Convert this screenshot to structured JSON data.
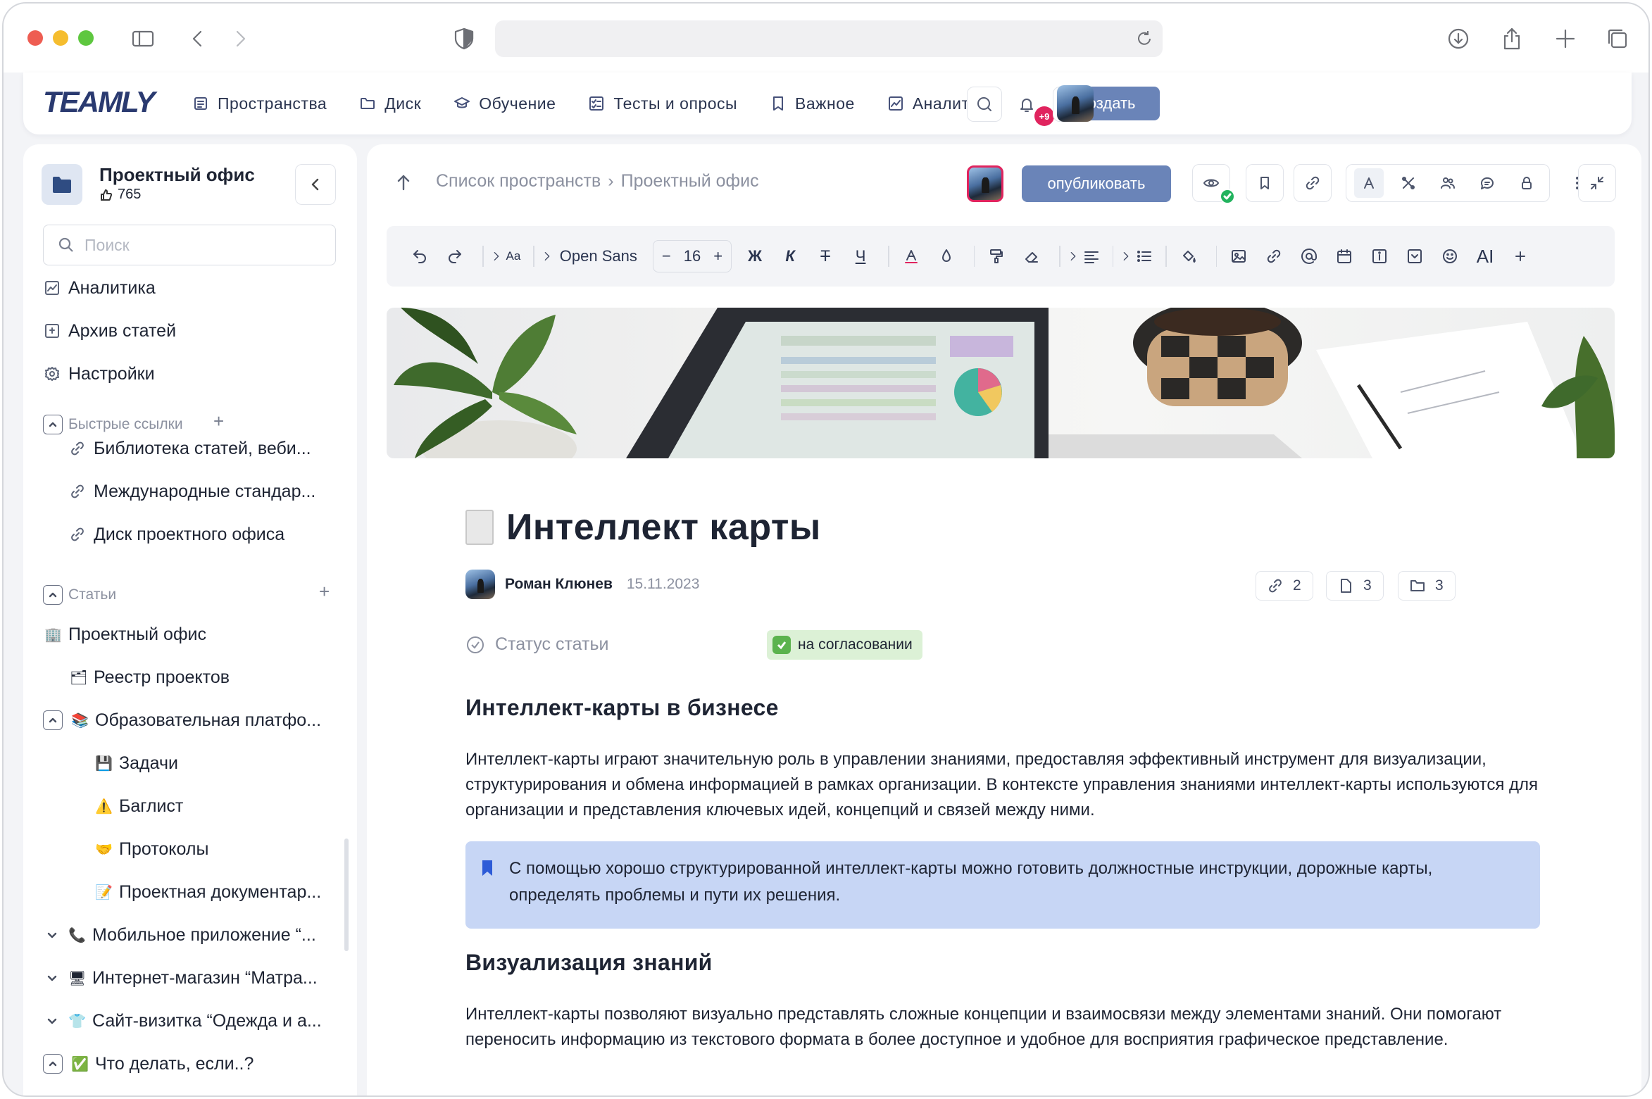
{
  "app": {
    "logo": "TEAMLY",
    "nav": [
      {
        "label": "Пространства",
        "icon": "spaces-icon"
      },
      {
        "label": "Диск",
        "icon": "folder-icon"
      },
      {
        "label": "Обучение",
        "icon": "graduation-icon"
      },
      {
        "label": "Тесты и опросы",
        "icon": "checklist-icon"
      },
      {
        "label": "Важное",
        "icon": "bookmark-icon"
      },
      {
        "label": "Аналитика",
        "icon": "analytics-icon"
      }
    ],
    "create_label": "создать",
    "notifications_badge": "+9"
  },
  "sidebar": {
    "space_title": "Проектный офис",
    "likes": "765",
    "search_placeholder": "Поиск",
    "top_items": [
      {
        "label": "Аналитика",
        "icon": "analytics-icon"
      },
      {
        "label": "Архив статей",
        "icon": "archive-icon"
      },
      {
        "label": "Настройки",
        "icon": "gear-icon"
      }
    ],
    "quick_links_title": "Быстрые ссылки",
    "quick_links": [
      "Библиотека статей, веби...",
      "Международные стандар...",
      "Диск проектного офиса"
    ],
    "articles_title": "Статьи",
    "articles": [
      {
        "label": "Проектный офис",
        "emoji": "🏢",
        "level": 0
      },
      {
        "label": "Реестр проектов",
        "emoji": "🗂",
        "level": 1
      },
      {
        "label": "Образовательная платфо...",
        "emoji": "📚",
        "level": 1
      },
      {
        "label": "Задачи",
        "emoji": "💾",
        "level": 2
      },
      {
        "label": "Баглист",
        "emoji": "⚠️",
        "level": 2
      },
      {
        "label": "Протоколы",
        "emoji": "🤝",
        "level": 2
      },
      {
        "label": "Проектная документар...",
        "emoji": "📝",
        "level": 2
      },
      {
        "label": "Мобильное приложение “...",
        "emoji": "📞",
        "level": 1
      },
      {
        "label": "Интернет-магазин “Матра...",
        "emoji": "🖥",
        "level": 1
      },
      {
        "label": "Сайт-визитка “Одежда и а...",
        "emoji": "👕",
        "level": 1
      },
      {
        "label": "Что делать, если..?",
        "emoji": "✅",
        "level": 0
      }
    ]
  },
  "main": {
    "breadcrumb": [
      "Список пространств",
      "Проектный офис"
    ],
    "publish_label": "опубликовать",
    "toolbar": {
      "font_family": "Open Sans",
      "font_size": "16",
      "bold": "Ж",
      "italic": "К",
      "strike": "Т",
      "underline": "Ч",
      "ai": "AI"
    },
    "article": {
      "title": "Интеллект карты",
      "author": "Роман Клюнев",
      "date": "15.11.2023",
      "counters": {
        "links": "2",
        "docs": "3",
        "folders": "3"
      },
      "status_label": "Статус статьи",
      "status_value": "на согласовании",
      "h2_1": "Интеллект-карты в бизнесе",
      "p1": "Интеллект-карты играют значительную роль в управлении знаниями, предоставляя эффективный инструмент для визуализации, структурирования и обмена информацией в рамках организации. В контексте управления знаниями интеллект-карты используются для организации и представления ключевых идей, концепций и связей между ними.",
      "callout": "С помощью хорошо структурированной интеллект-карты можно готовить должностные инструкции, дорожные карты, определять проблемы и пути их решения.",
      "h2_2": "Визуализация знаний",
      "p2": "Интеллект-карты позволяют визуально представлять сложные концепции и взаимосвязи между элементами знаний. Они помогают переносить информацию из текстового формата в более доступное и удобное для восприятия графическое представление."
    }
  },
  "colors": {
    "accent": "#6a84b8",
    "brand": "#2a3a70",
    "status_green": "#5bb34e",
    "callout_bg": "#c7d6f5",
    "notification": "#e0245e"
  }
}
